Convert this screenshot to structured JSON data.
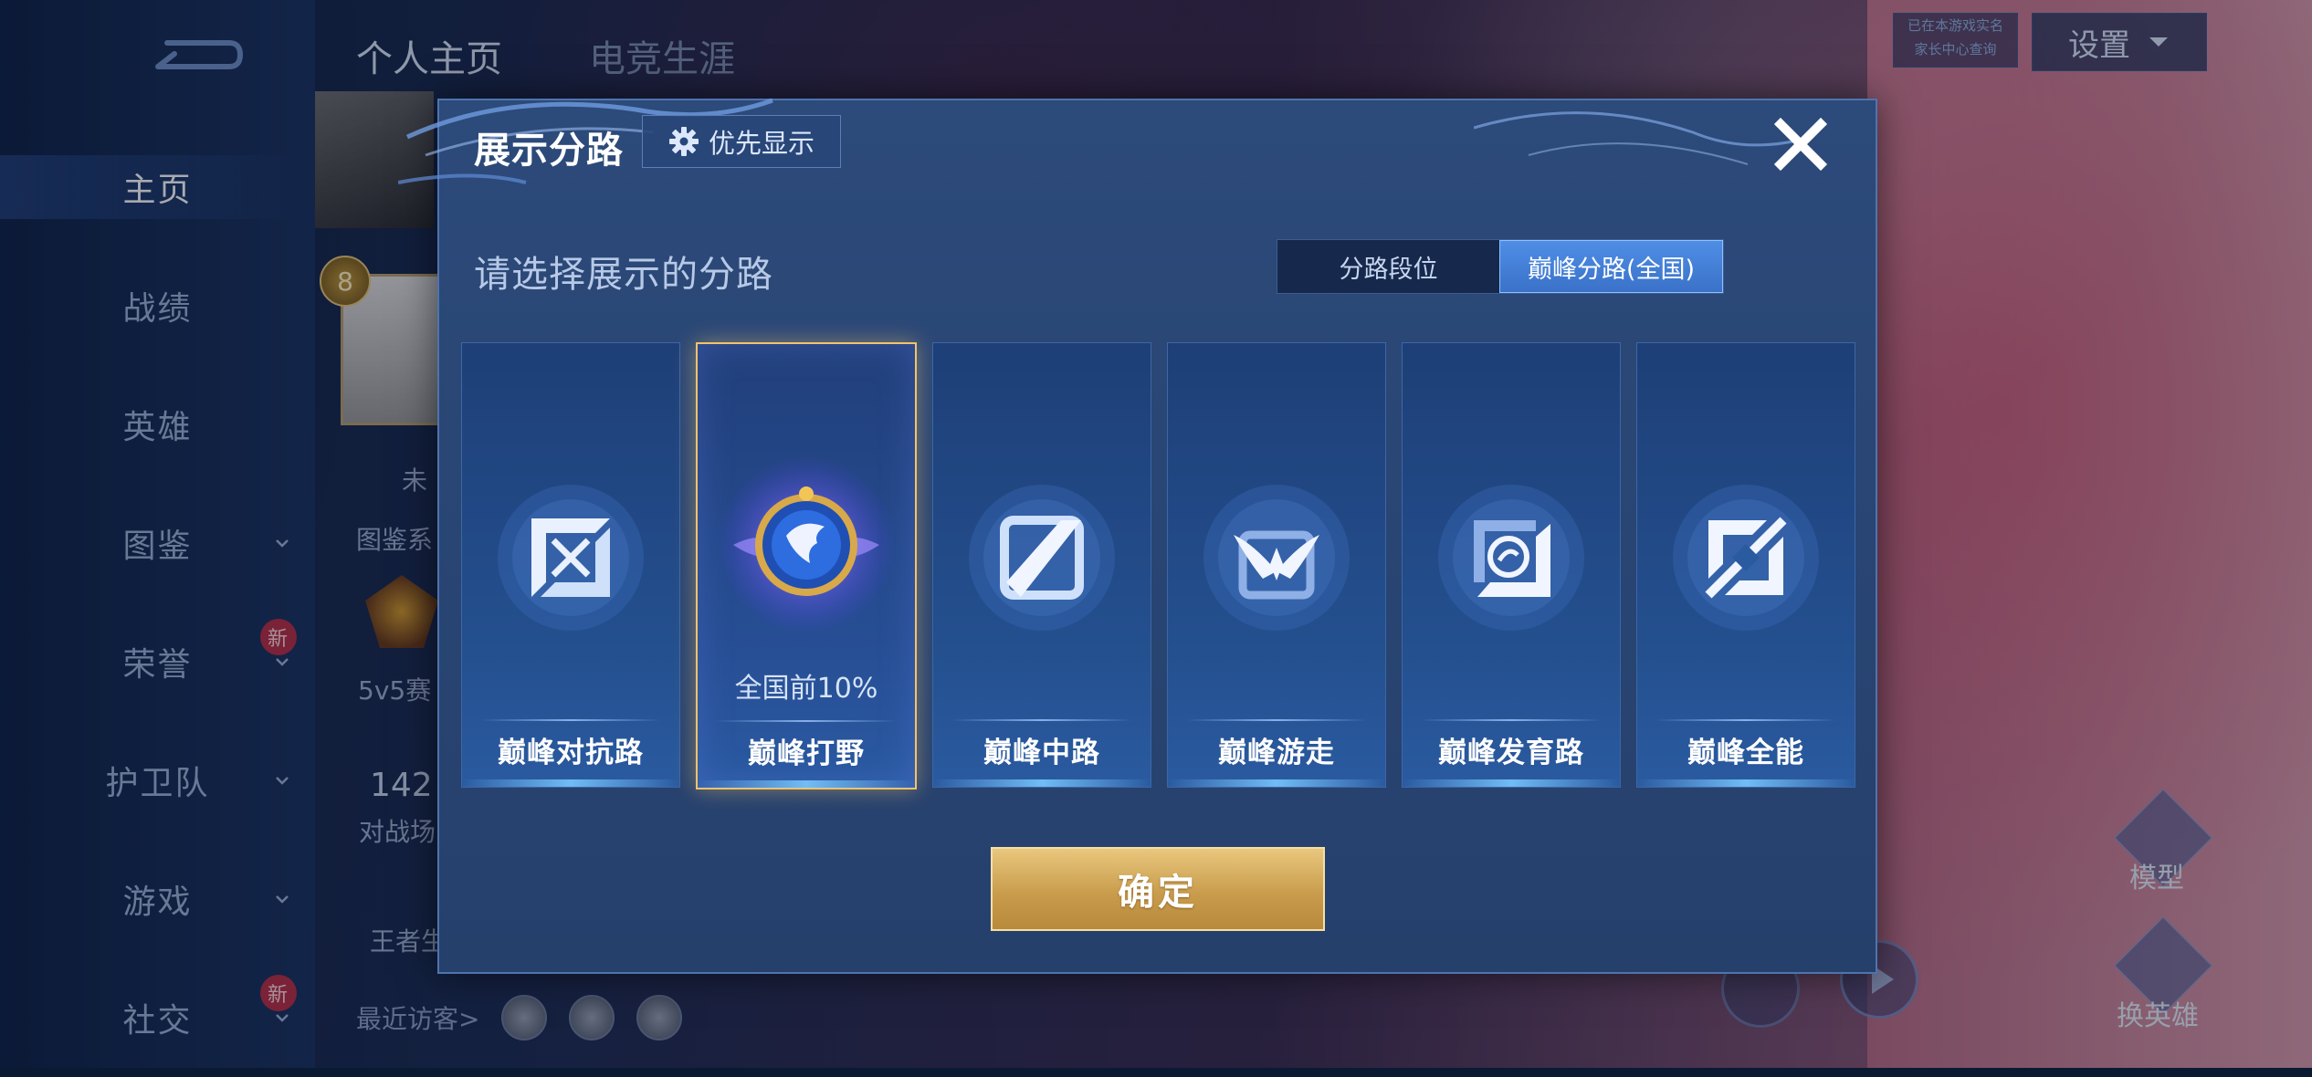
{
  "colors": {
    "accent_gold": "#f1c36a",
    "accent_blue": "#4f8ee6",
    "dialog_bg": "#2c4a7a"
  },
  "background": {
    "top_tabs": [
      {
        "label": "个人主页",
        "active": true
      },
      {
        "label": "电竞生涯",
        "active": false
      }
    ],
    "sidebar": {
      "items": [
        {
          "label": "主页",
          "active": true,
          "chevron": false,
          "new": false
        },
        {
          "label": "战绩",
          "active": false,
          "chevron": false,
          "new": false
        },
        {
          "label": "英雄",
          "active": false,
          "chevron": false,
          "new": false
        },
        {
          "label": "图鉴",
          "active": false,
          "chevron": true,
          "new": false
        },
        {
          "label": "荣誉",
          "active": false,
          "chevron": true,
          "new": true
        },
        {
          "label": "护卫队",
          "active": false,
          "chevron": true,
          "new": false
        },
        {
          "label": "游戏",
          "active": false,
          "chevron": true,
          "new": false
        },
        {
          "label": "社交",
          "active": false,
          "chevron": true,
          "new": true
        }
      ],
      "new_badge": "新"
    },
    "profile": {
      "level": "8",
      "partial_texts": [
        "未",
        "图鉴系",
        "5v5赛",
        "142",
        "对战场",
        "王者生"
      ]
    },
    "settings_label": "设置",
    "status_box": [
      "已在本游戏实名",
      "家长中心查询"
    ],
    "right_buttons": [
      {
        "label": "模型",
        "icon": "figure-icon"
      },
      {
        "label": "换英雄",
        "icon": "hero-swap-icon"
      }
    ],
    "visitors_label": "最近访客>"
  },
  "dialog": {
    "title": "展示分路",
    "priority_label": "优先显示",
    "prompt": "请选择展示的分路",
    "toggle": [
      {
        "label": "分路段位",
        "active": false
      },
      {
        "label": "巅峰分路(全国)",
        "active": true
      }
    ],
    "lanes": [
      {
        "name": "巅峰对抗路",
        "icon": "clash-lane-icon",
        "selected": false,
        "rank": ""
      },
      {
        "name": "巅峰打野",
        "icon": "jungle-emblem-icon",
        "selected": true,
        "rank": "全国前10%"
      },
      {
        "name": "巅峰中路",
        "icon": "mid-lane-icon",
        "selected": false,
        "rank": ""
      },
      {
        "name": "巅峰游走",
        "icon": "roam-icon",
        "selected": false,
        "rank": ""
      },
      {
        "name": "巅峰发育路",
        "icon": "farm-lane-icon",
        "selected": false,
        "rank": ""
      },
      {
        "name": "巅峰全能",
        "icon": "all-round-icon",
        "selected": false,
        "rank": ""
      }
    ],
    "confirm_label": "确定"
  }
}
